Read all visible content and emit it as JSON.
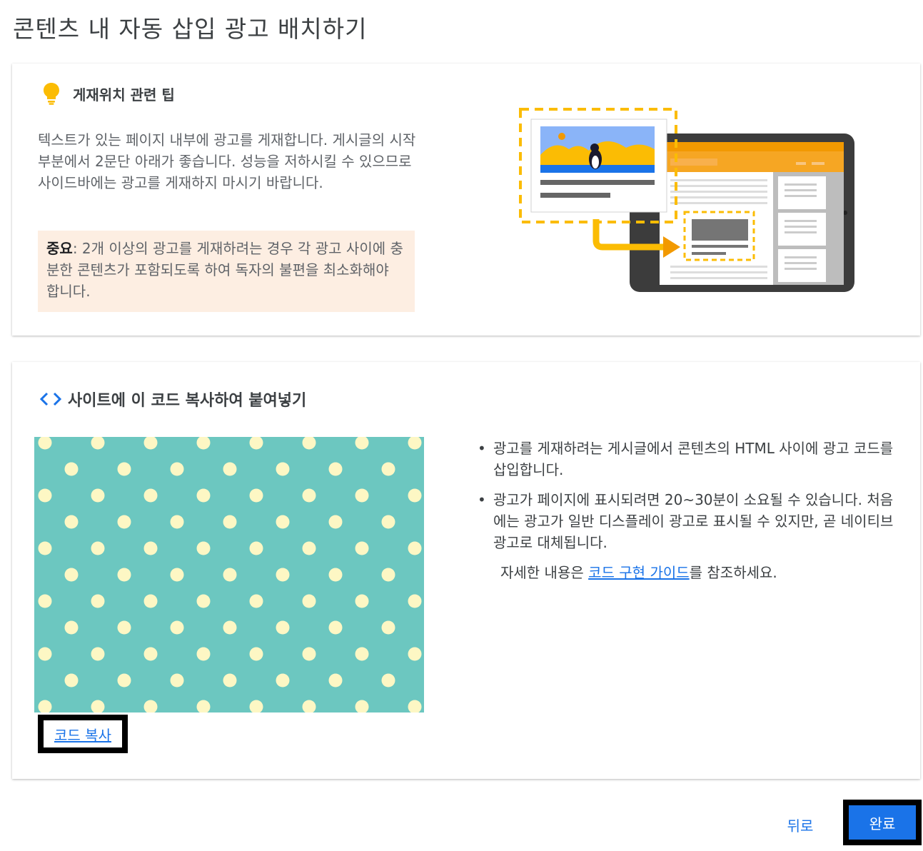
{
  "page": {
    "title": "콘텐츠 내 자동 삽입 광고 배치하기"
  },
  "tip_card": {
    "icon": "lightbulb-icon",
    "title": "게재위치 관련 팁",
    "body": "텍스트가 있는 페이지 내부에 광고를 게재합니다. 게시글의 시작 부분에서 2문단 아래가 좋습니다. 성능을 저하시킬 수 있으므로 사이드바에는 광고를 게재하지 마시기 바랍니다.",
    "notice_strong": "중요",
    "notice_text": ": 2개 이상의 광고를 게재하려는 경우 각 광고 사이에 충분한 콘텐츠가 포함되도록 하여 독자의 불편을 최소화해야 합니다."
  },
  "code_card": {
    "icon": "code-brackets-icon",
    "title": "사이트에 이 코드 복사하여 붙여넣기",
    "copy_label": "코드 복사",
    "instructions": [
      "광고를 게재하려는 게시글에서 콘텐츠의 HTML 사이에 광고 코드를 삽입합니다.",
      "광고가 페이지에 표시되려면 20~30분이 소요될 수 있습니다. 처음에는 광고가 일반 디스플레이 광고로 표시될 수 있지만, 곧 네이티브 광고로 대체됩니다."
    ],
    "more_prefix": "자세한 내용은 ",
    "more_link": "코드 구현 가이드",
    "more_suffix": "를 참조하세요."
  },
  "footer": {
    "back_label": "뒤로",
    "done_label": "완료"
  },
  "colors": {
    "accent": "#1a73e8",
    "notice_bg": "#fdeee2",
    "illustration_orange": "#f29900",
    "illustration_yellow": "#fbbc04",
    "pattern_bg": "#6cc7c0",
    "pattern_dot": "#fdf7c4"
  }
}
